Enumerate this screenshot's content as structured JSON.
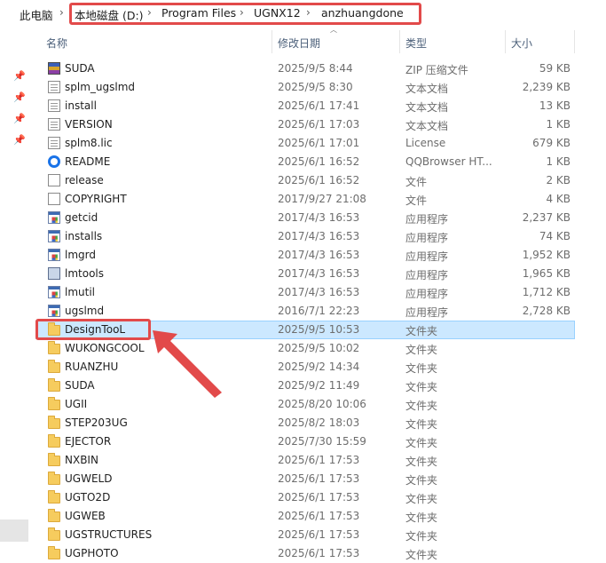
{
  "address_bar": {
    "crumbs": [
      "此电脑",
      "本地磁盘 (D:)",
      "Program Files",
      "UGNX12",
      "anzhuangdone"
    ],
    "separator": "›"
  },
  "columns": {
    "name": "名称",
    "date": "修改日期",
    "type": "类型",
    "size": "大小"
  },
  "files": [
    {
      "name": "SUDA",
      "date": "2025/9/5 8:44",
      "type": "ZIP 压缩文件",
      "size": "59 KB",
      "icon": "zip-icon"
    },
    {
      "name": "splm_ugslmd",
      "date": "2025/9/5 8:30",
      "type": "文本文档",
      "size": "2,239 KB",
      "icon": "text-file-icon"
    },
    {
      "name": "install",
      "date": "2025/6/1 17:41",
      "type": "文本文档",
      "size": "13 KB",
      "icon": "text-file-icon"
    },
    {
      "name": "VERSION",
      "date": "2025/6/1 17:03",
      "type": "文本文档",
      "size": "1 KB",
      "icon": "text-file-icon"
    },
    {
      "name": "splm8.lic",
      "date": "2025/6/1 17:01",
      "type": "License",
      "size": "679 KB",
      "icon": "text-file-icon"
    },
    {
      "name": "README",
      "date": "2025/6/1 16:52",
      "type": "QQBrowser HT...",
      "size": "1 KB",
      "icon": "qqbrowser-icon"
    },
    {
      "name": "release",
      "date": "2025/6/1 16:52",
      "type": "文件",
      "size": "2 KB",
      "icon": "blank-file-icon"
    },
    {
      "name": "COPYRIGHT",
      "date": "2017/9/27 21:08",
      "type": "文件",
      "size": "4 KB",
      "icon": "blank-file-icon"
    },
    {
      "name": "getcid",
      "date": "2017/4/3 16:53",
      "type": "应用程序",
      "size": "2,237 KB",
      "icon": "application-icon"
    },
    {
      "name": "installs",
      "date": "2017/4/3 16:53",
      "type": "应用程序",
      "size": "74 KB",
      "icon": "application-icon"
    },
    {
      "name": "lmgrd",
      "date": "2017/4/3 16:53",
      "type": "应用程序",
      "size": "1,952 KB",
      "icon": "application-icon"
    },
    {
      "name": "lmtools",
      "date": "2017/4/3 16:53",
      "type": "应用程序",
      "size": "1,965 KB",
      "icon": "tool-app-icon"
    },
    {
      "name": "lmutil",
      "date": "2017/4/3 16:53",
      "type": "应用程序",
      "size": "1,712 KB",
      "icon": "application-icon"
    },
    {
      "name": "ugslmd",
      "date": "2016/7/1 22:23",
      "type": "应用程序",
      "size": "2,728 KB",
      "icon": "application-icon"
    },
    {
      "name": "DesignTooL",
      "date": "2025/9/5 10:53",
      "type": "文件夹",
      "size": "",
      "icon": "folder-icon",
      "selected": true
    },
    {
      "name": "WUKONGCOOL",
      "date": "2025/9/5 10:02",
      "type": "文件夹",
      "size": "",
      "icon": "folder-icon"
    },
    {
      "name": "RUANZHU",
      "date": "2025/9/2 14:34",
      "type": "文件夹",
      "size": "",
      "icon": "folder-icon"
    },
    {
      "name": "SUDA",
      "date": "2025/9/2 11:49",
      "type": "文件夹",
      "size": "",
      "icon": "folder-icon"
    },
    {
      "name": "UGII",
      "date": "2025/8/20 10:06",
      "type": "文件夹",
      "size": "",
      "icon": "folder-icon"
    },
    {
      "name": "STEP203UG",
      "date": "2025/8/2 18:03",
      "type": "文件夹",
      "size": "",
      "icon": "folder-icon"
    },
    {
      "name": "EJECTOR",
      "date": "2025/7/30 15:59",
      "type": "文件夹",
      "size": "",
      "icon": "folder-icon"
    },
    {
      "name": "NXBIN",
      "date": "2025/6/1 17:53",
      "type": "文件夹",
      "size": "",
      "icon": "folder-icon"
    },
    {
      "name": "UGWELD",
      "date": "2025/6/1 17:53",
      "type": "文件夹",
      "size": "",
      "icon": "folder-icon"
    },
    {
      "name": "UGTO2D",
      "date": "2025/6/1 17:53",
      "type": "文件夹",
      "size": "",
      "icon": "folder-icon"
    },
    {
      "name": "UGWEB",
      "date": "2025/6/1 17:53",
      "type": "文件夹",
      "size": "",
      "icon": "folder-icon"
    },
    {
      "name": "UGSTRUCTURES",
      "date": "2025/6/1 17:53",
      "type": "文件夹",
      "size": "",
      "icon": "folder-icon"
    },
    {
      "name": "UGPHOTO",
      "date": "2025/6/1 17:53",
      "type": "文件夹",
      "size": "",
      "icon": "folder-icon"
    }
  ],
  "colors": {
    "highlight_red": "#e24a4a",
    "selection_blue": "#cce8ff",
    "folder_yellow": "#f6cc5e"
  }
}
